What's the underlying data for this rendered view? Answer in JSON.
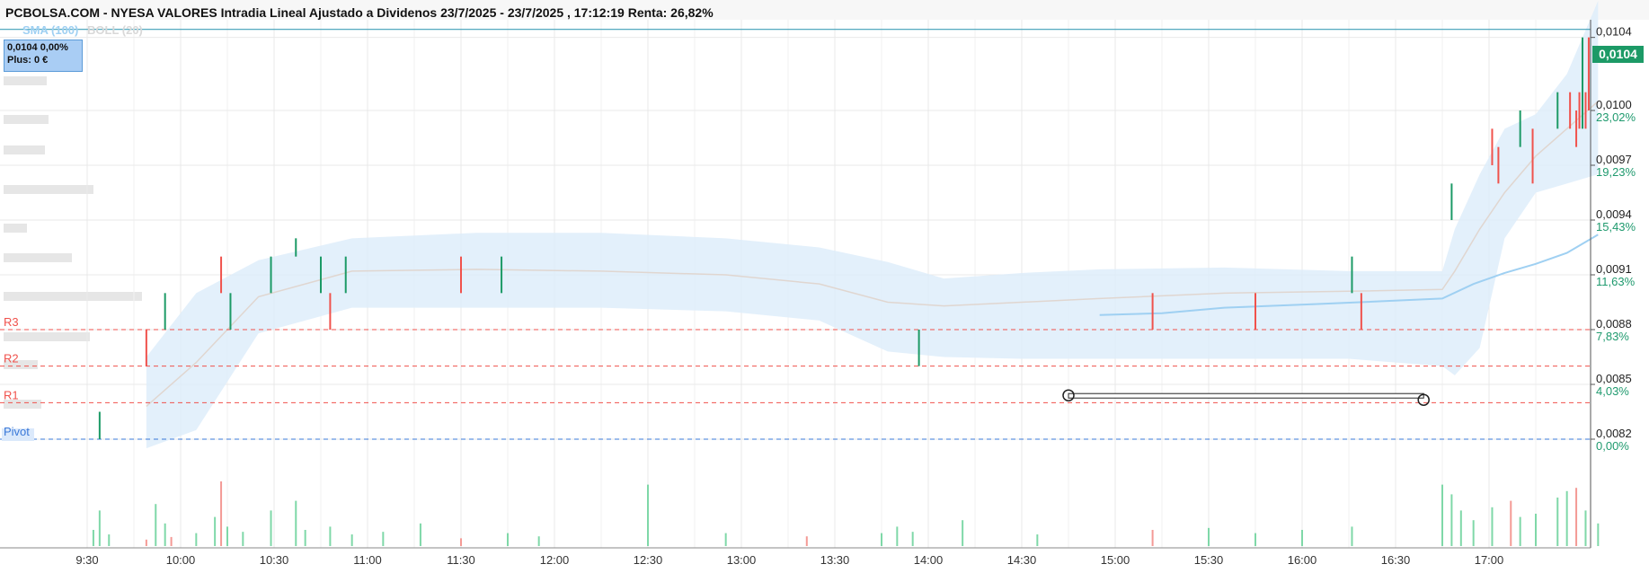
{
  "header": {
    "title": "PCBOLSA.COM - NYESA VALORES Intradia Lineal Ajustado a Dividenos 23/7/2025 - 23/7/2025 , 17:12:19 Renta: 26,82%"
  },
  "legend": {
    "sma": "SMA (100)",
    "boll": "BOLL (20)"
  },
  "info_box": {
    "price_line": "0,0104  0,00%",
    "plus_line": "Plus: 0 €"
  },
  "price_tag": "0,0104",
  "colors": {
    "up": "#1c9a66",
    "down": "#f0524c",
    "sma": "#9fd0f2",
    "boll_fill": "#dcecfa",
    "pivot": "#3a78d8",
    "resistance": "#f0524c",
    "grid": "#e9e9e9"
  },
  "chart_data": {
    "type": "bar",
    "title": "PCBOLSA.COM - NYESA VALORES Intradia Lineal Ajustado a Dividenos 23/7/2025 - 23/7/2025 , 17:12:19 Renta: 26,82%",
    "x_ticks": [
      "9:30",
      "10:00",
      "10:30",
      "11:00",
      "11:30",
      "12:00",
      "12:30",
      "13:00",
      "13:30",
      "14:00",
      "14:30",
      "15:00",
      "15:30",
      "16:00",
      "16:30",
      "17:00"
    ],
    "y_ticks": [
      {
        "price": "0,0104",
        "pct": ""
      },
      {
        "price": "0,0100",
        "pct": "23,02%"
      },
      {
        "price": "0,0097",
        "pct": "19,23%"
      },
      {
        "price": "0,0094",
        "pct": "15,43%"
      },
      {
        "price": "0,0091",
        "pct": "11,63%"
      },
      {
        "price": "0,0088",
        "pct": "7,83%"
      },
      {
        "price": "0,0085",
        "pct": "4,03%"
      },
      {
        "price": "0,0082",
        "pct": "0,00%"
      }
    ],
    "ylim": [
      0.00807,
      0.01055
    ],
    "xlim_minutes": [
      555,
      1035
    ],
    "levels": [
      {
        "name": "R3",
        "value": 0.0088,
        "style": "resistance"
      },
      {
        "name": "R2",
        "value": 0.0086,
        "style": "resistance"
      },
      {
        "name": "R1",
        "value": 0.0084,
        "style": "resistance"
      },
      {
        "name": "Pivot",
        "value": 0.0082,
        "style": "pivot"
      }
    ],
    "last_price": 0.0104,
    "candles": [
      {
        "t": 559,
        "low": 0.0082,
        "high": 0.00835,
        "dir": "up"
      },
      {
        "t": 574,
        "low": 0.0086,
        "high": 0.0088,
        "dir": "down"
      },
      {
        "t": 580,
        "low": 0.0088,
        "high": 0.009,
        "dir": "up"
      },
      {
        "t": 598,
        "low": 0.009,
        "high": 0.0092,
        "dir": "down"
      },
      {
        "t": 601,
        "low": 0.0088,
        "high": 0.009,
        "dir": "up"
      },
      {
        "t": 614,
        "low": 0.009,
        "high": 0.0092,
        "dir": "up"
      },
      {
        "t": 622,
        "low": 0.0092,
        "high": 0.0093,
        "dir": "up"
      },
      {
        "t": 630,
        "low": 0.009,
        "high": 0.0092,
        "dir": "up"
      },
      {
        "t": 633,
        "low": 0.0088,
        "high": 0.009,
        "dir": "down"
      },
      {
        "t": 638,
        "low": 0.009,
        "high": 0.0092,
        "dir": "up"
      },
      {
        "t": 675,
        "low": 0.009,
        "high": 0.0092,
        "dir": "down"
      },
      {
        "t": 688,
        "low": 0.009,
        "high": 0.0092,
        "dir": "up"
      },
      {
        "t": 822,
        "low": 0.0086,
        "high": 0.0088,
        "dir": "up"
      },
      {
        "t": 897,
        "low": 0.0088,
        "high": 0.009,
        "dir": "down"
      },
      {
        "t": 930,
        "low": 0.0088,
        "high": 0.009,
        "dir": "down"
      },
      {
        "t": 961,
        "low": 0.009,
        "high": 0.0092,
        "dir": "up"
      },
      {
        "t": 964,
        "low": 0.0088,
        "high": 0.009,
        "dir": "down"
      },
      {
        "t": 993,
        "low": 0.0094,
        "high": 0.0096,
        "dir": "up"
      },
      {
        "t": 1006,
        "low": 0.0097,
        "high": 0.0099,
        "dir": "down"
      },
      {
        "t": 1008,
        "low": 0.0096,
        "high": 0.0098,
        "dir": "down"
      },
      {
        "t": 1015,
        "low": 0.0098,
        "high": 0.01,
        "dir": "up"
      },
      {
        "t": 1019,
        "low": 0.0096,
        "high": 0.0099,
        "dir": "down"
      },
      {
        "t": 1027,
        "low": 0.0099,
        "high": 0.0101,
        "dir": "up"
      },
      {
        "t": 1031,
        "low": 0.0099,
        "high": 0.0101,
        "dir": "down"
      },
      {
        "t": 1033,
        "low": 0.0098,
        "high": 0.01,
        "dir": "down"
      },
      {
        "t": 1034,
        "low": 0.0099,
        "high": 0.0101,
        "dir": "down"
      },
      {
        "t": 1035,
        "low": 0.0099,
        "high": 0.0104,
        "dir": "up"
      },
      {
        "t": 1036,
        "low": 0.0099,
        "high": 0.0101,
        "dir": "down"
      },
      {
        "t": 1037,
        "low": 0.01,
        "high": 0.0104,
        "dir": "down"
      }
    ],
    "bollinger": {
      "t": [
        574,
        590,
        610,
        640,
        680,
        720,
        760,
        790,
        812,
        830,
        855,
        880,
        920,
        960,
        990,
        994,
        1002,
        1010,
        1020,
        1030,
        1040
      ],
      "upper": [
        0.00865,
        0.009,
        0.00918,
        0.0093,
        0.00933,
        0.00933,
        0.0093,
        0.00925,
        0.00917,
        0.00908,
        0.00911,
        0.00913,
        0.00914,
        0.00912,
        0.00912,
        0.00935,
        0.00965,
        0.0099,
        0.00998,
        0.0102,
        0.0106
      ],
      "lower": [
        0.00815,
        0.00825,
        0.00878,
        0.00892,
        0.00892,
        0.00892,
        0.0089,
        0.00885,
        0.00868,
        0.00865,
        0.00864,
        0.00864,
        0.00864,
        0.00864,
        0.0086,
        0.00855,
        0.0087,
        0.0093,
        0.00955,
        0.0096,
        0.00965
      ],
      "mid": [
        0.00838,
        0.00862,
        0.00898,
        0.00912,
        0.00913,
        0.00912,
        0.0091,
        0.00905,
        0.00895,
        0.00893,
        0.00895,
        0.00897,
        0.009,
        0.00901,
        0.00902,
        0.00912,
        0.00935,
        0.00955,
        0.00975,
        0.0099,
        0.01005
      ]
    },
    "sma": {
      "t": [
        880,
        900,
        920,
        950,
        990,
        1000,
        1010,
        1020,
        1030,
        1040
      ],
      "value": [
        0.00888,
        0.00889,
        0.00892,
        0.00894,
        0.00897,
        0.00905,
        0.00911,
        0.00916,
        0.00922,
        0.00932
      ]
    },
    "volume": [
      {
        "t": 557,
        "v": 0.25,
        "dir": "up"
      },
      {
        "t": 559,
        "v": 0.55,
        "dir": "up"
      },
      {
        "t": 562,
        "v": 0.18,
        "dir": "up"
      },
      {
        "t": 574,
        "v": 0.1,
        "dir": "down"
      },
      {
        "t": 577,
        "v": 0.65,
        "dir": "up"
      },
      {
        "t": 580,
        "v": 0.35,
        "dir": "up"
      },
      {
        "t": 582,
        "v": 0.14,
        "dir": "down"
      },
      {
        "t": 590,
        "v": 0.2,
        "dir": "up"
      },
      {
        "t": 596,
        "v": 0.45,
        "dir": "up"
      },
      {
        "t": 598,
        "v": 1.0,
        "dir": "down"
      },
      {
        "t": 600,
        "v": 0.3,
        "dir": "up"
      },
      {
        "t": 605,
        "v": 0.22,
        "dir": "up"
      },
      {
        "t": 614,
        "v": 0.55,
        "dir": "up"
      },
      {
        "t": 622,
        "v": 0.7,
        "dir": "up"
      },
      {
        "t": 625,
        "v": 0.25,
        "dir": "up"
      },
      {
        "t": 633,
        "v": 0.3,
        "dir": "up"
      },
      {
        "t": 640,
        "v": 0.18,
        "dir": "up"
      },
      {
        "t": 650,
        "v": 0.22,
        "dir": "up"
      },
      {
        "t": 662,
        "v": 0.35,
        "dir": "up"
      },
      {
        "t": 675,
        "v": 0.12,
        "dir": "down"
      },
      {
        "t": 690,
        "v": 0.2,
        "dir": "up"
      },
      {
        "t": 700,
        "v": 0.15,
        "dir": "up"
      },
      {
        "t": 735,
        "v": 0.95,
        "dir": "up"
      },
      {
        "t": 760,
        "v": 0.2,
        "dir": "up"
      },
      {
        "t": 786,
        "v": 0.15,
        "dir": "down"
      },
      {
        "t": 810,
        "v": 0.2,
        "dir": "up"
      },
      {
        "t": 815,
        "v": 0.3,
        "dir": "up"
      },
      {
        "t": 820,
        "v": 0.22,
        "dir": "up"
      },
      {
        "t": 836,
        "v": 0.4,
        "dir": "up"
      },
      {
        "t": 860,
        "v": 0.18,
        "dir": "up"
      },
      {
        "t": 897,
        "v": 0.25,
        "dir": "down"
      },
      {
        "t": 915,
        "v": 0.28,
        "dir": "up"
      },
      {
        "t": 930,
        "v": 0.2,
        "dir": "up"
      },
      {
        "t": 945,
        "v": 0.25,
        "dir": "up"
      },
      {
        "t": 961,
        "v": 0.3,
        "dir": "up"
      },
      {
        "t": 990,
        "v": 0.95,
        "dir": "up"
      },
      {
        "t": 993,
        "v": 0.8,
        "dir": "up"
      },
      {
        "t": 996,
        "v": 0.55,
        "dir": "up"
      },
      {
        "t": 1000,
        "v": 0.4,
        "dir": "up"
      },
      {
        "t": 1006,
        "v": 0.6,
        "dir": "up"
      },
      {
        "t": 1012,
        "v": 0.7,
        "dir": "down"
      },
      {
        "t": 1015,
        "v": 0.45,
        "dir": "up"
      },
      {
        "t": 1020,
        "v": 0.5,
        "dir": "up"
      },
      {
        "t": 1027,
        "v": 0.75,
        "dir": "up"
      },
      {
        "t": 1030,
        "v": 0.85,
        "dir": "up"
      },
      {
        "t": 1033,
        "v": 0.9,
        "dir": "down"
      },
      {
        "t": 1036,
        "v": 0.55,
        "dir": "up"
      },
      {
        "t": 1040,
        "v": 0.35,
        "dir": "up"
      }
    ],
    "drawing_line": {
      "t1": 870,
      "t2": 984,
      "value": 0.00844
    },
    "grid": true
  }
}
